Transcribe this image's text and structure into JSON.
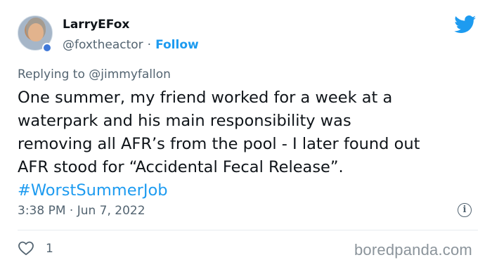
{
  "tweet": {
    "author": {
      "display_name": "LarryEFox",
      "handle": "@foxtheactor",
      "separator": "·",
      "follow_label": "Follow"
    },
    "reply": {
      "prefix": "Replying to",
      "mention": "@jimmyfallon"
    },
    "text_lines": [
      "One summer, my friend worked for a week at a",
      "waterpark and his main responsibility was",
      "removing all AFR’s from the pool - I later found out",
      "AFR stood for “Accidental Fecal Release”."
    ],
    "hashtag": "#WorstSummerJob",
    "timestamp": "3:38 PM · Jun 7, 2022",
    "info_icon_glyph": "i",
    "likes": "1",
    "icons": [
      "twitter-bird-icon",
      "info-icon",
      "heart-icon"
    ],
    "colors": {
      "accent": "#1d9bf0",
      "secondary_text": "#536471",
      "primary_text": "#0f1419"
    }
  },
  "watermark": "boredpanda.com"
}
